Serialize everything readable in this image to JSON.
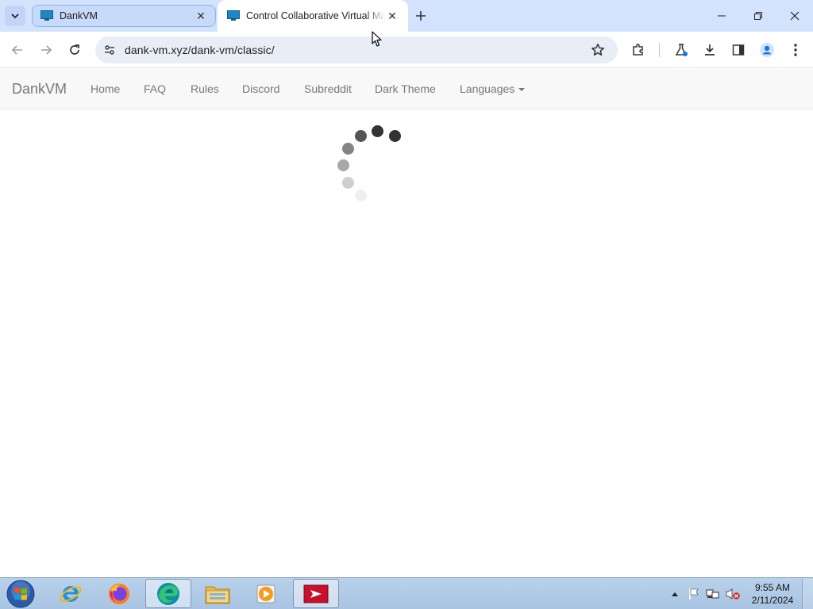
{
  "browser": {
    "tabs": [
      {
        "title": "DankVM",
        "active": false
      },
      {
        "title": "Control Collaborative Virtual Machines",
        "active": true
      }
    ],
    "address": "dank-vm.xyz/dank-vm/classic/"
  },
  "site": {
    "brand": "DankVM",
    "nav": {
      "home": "Home",
      "faq": "FAQ",
      "rules": "Rules",
      "discord": "Discord",
      "subreddit": "Subreddit",
      "dark_theme": "Dark Theme",
      "languages": "Languages"
    },
    "loading": true
  },
  "taskbar": {
    "apps": [
      "internet-explorer-icon",
      "firefox-icon",
      "edge-icon",
      "file-explorer-icon",
      "media-player-icon",
      "remote-app-icon"
    ],
    "clock": {
      "time": "9:55 AM",
      "date": "2/11/2024"
    }
  },
  "colors": {
    "tabstrip": "#d3e3fd",
    "omnibox": "#e9eef6",
    "navbar": "#f8f8f8",
    "navtext": "#777777",
    "taskbar": "#b9d1ea"
  }
}
